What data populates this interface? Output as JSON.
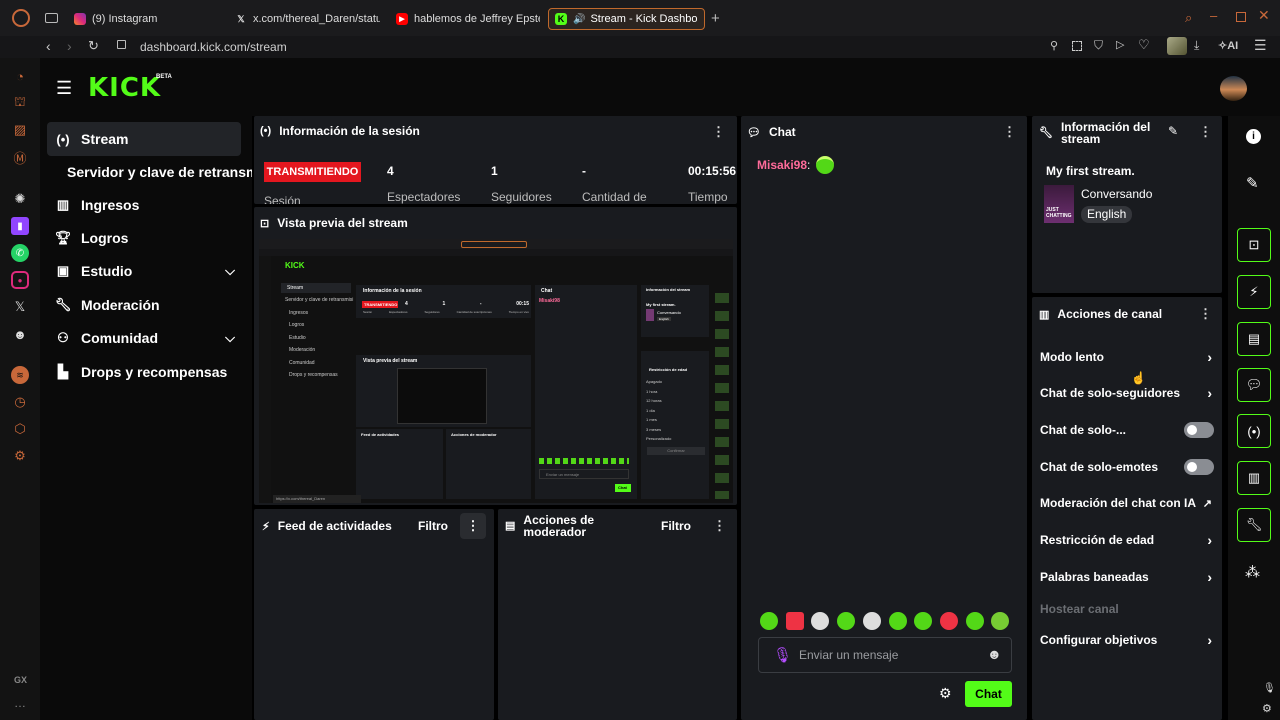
{
  "browser": {
    "tabs": [
      {
        "label": "(9) Instagram",
        "icon": "instagram-icon"
      },
      {
        "label": "x.com/thereal_Daren/statu",
        "icon": "x-icon"
      },
      {
        "label": "hablemos de Jeffrey Epste",
        "icon": "youtube-icon"
      },
      {
        "label": "Stream - Kick Dashbo",
        "icon": "kick-icon"
      }
    ],
    "url": "dashboard.kick.com/stream",
    "ai_label": "AI",
    "gx_label": "GX"
  },
  "logo": {
    "text": "KICK",
    "badge": "BETA"
  },
  "nav": {
    "stream": "Stream",
    "servidor": "Servidor y clave de retransm",
    "ingresos": "Ingresos",
    "logros": "Logros",
    "estudio": "Estudio",
    "moderacion": "Moderación",
    "comunidad": "Comunidad",
    "drops": "Drops y recompensas"
  },
  "session": {
    "title": "Información de la sesión",
    "status": "TRANSMITIENDO",
    "status_sub": "Sesión",
    "stats": [
      {
        "value": "4",
        "label": "Espectadores"
      },
      {
        "value": "1",
        "label": "Seguidores"
      },
      {
        "value": "-",
        "label": "Cantidad de"
      },
      {
        "value": "00:15:56",
        "label": "Tiempo"
      }
    ]
  },
  "preview": {
    "title": "Vista previa del stream"
  },
  "feed": {
    "title": "Feed de actividades",
    "filter": "Filtro"
  },
  "modactions": {
    "title_line1": "Acciones de",
    "title_line2": "moderador",
    "filter": "Filtro"
  },
  "chat": {
    "title": "Chat",
    "username": "Misaki98",
    "placeholder": "Enviar un mensaje",
    "send_label": "Chat",
    "user_color": "#ff6b9a"
  },
  "stream_info": {
    "title_line1": "Información del",
    "title_line2": "stream",
    "stream_title": "My first stream.",
    "category": "Conversando",
    "language": "English",
    "thumb_text": "JUST CHATTING"
  },
  "channel_actions": {
    "title": "Acciones de canal",
    "items": [
      {
        "label": "Modo lento",
        "control": "arrow"
      },
      {
        "label": "Chat de solo-seguidores",
        "control": "arrow"
      },
      {
        "label": "Chat de solo-...",
        "control": "toggle"
      },
      {
        "label": "Chat de solo-emotes",
        "control": "toggle"
      },
      {
        "label": "Moderación del chat con IA",
        "control": "external"
      },
      {
        "label": "Restricción de edad",
        "control": "arrow"
      },
      {
        "label": "Palabras baneadas",
        "control": "arrow"
      },
      {
        "label": "Hostear canal",
        "control": "disabled"
      },
      {
        "label": "Configurar objetivos",
        "control": "arrow"
      }
    ]
  },
  "mini": {
    "stream": "Stream",
    "servidor": "Servidor y clave de retransmisi",
    "ingresos": "Ingresos",
    "logros": "Logros",
    "estudio": "Estudio",
    "moderacion": "Moderación",
    "comunidad": "Comunidad",
    "drops": "Drops y recompensas",
    "session_title": "Información de la sesión",
    "status": "TRANSMITIENDO",
    "stat_values": [
      "4",
      "1",
      "-",
      "00:15"
    ],
    "stat_labels": [
      "Sesión",
      "Espectadores",
      "Seguidores",
      "Cantidad de suscripciones",
      "Tiempo en vivo"
    ],
    "preview_title": "Vista previa del stream",
    "feed_title": "Feed de actividades",
    "mod_title": "Acciones de moderador",
    "chat_title": "Chat",
    "chat_user": "Misaki98",
    "placeholder": "Enviar un mensaje",
    "send": "Chat",
    "info_title": "Información del stream",
    "info_stream_title": "My first stream.",
    "info_category": "Conversando",
    "info_lang": "English",
    "age_title": "Restricción de edad",
    "age_options": [
      "Apagado",
      "1 hora",
      "12 horas",
      "1 día",
      "1 mes",
      "3 meses",
      "Personalizado"
    ],
    "confirm": "Confirmar",
    "hover_url": "https://x.com/thereal_Daren"
  },
  "colors": {
    "accent": "#53fc18",
    "live": "#e4171f",
    "panel": "#191b1f"
  }
}
